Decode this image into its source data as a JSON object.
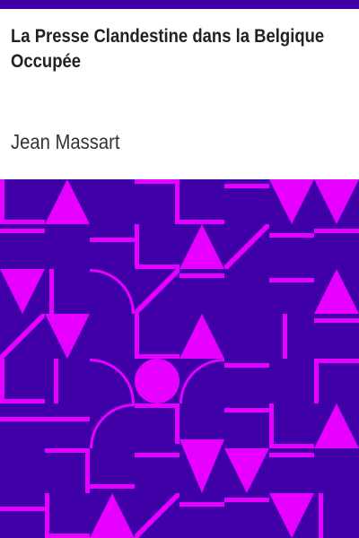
{
  "book": {
    "title": "La Presse Clandestine dans la Belgique Occupée",
    "author": "Jean Massart"
  },
  "colors": {
    "header_bar": "#3f00a8",
    "pattern_background": "#3f00a8",
    "pattern_foreground": "#e600ff"
  }
}
